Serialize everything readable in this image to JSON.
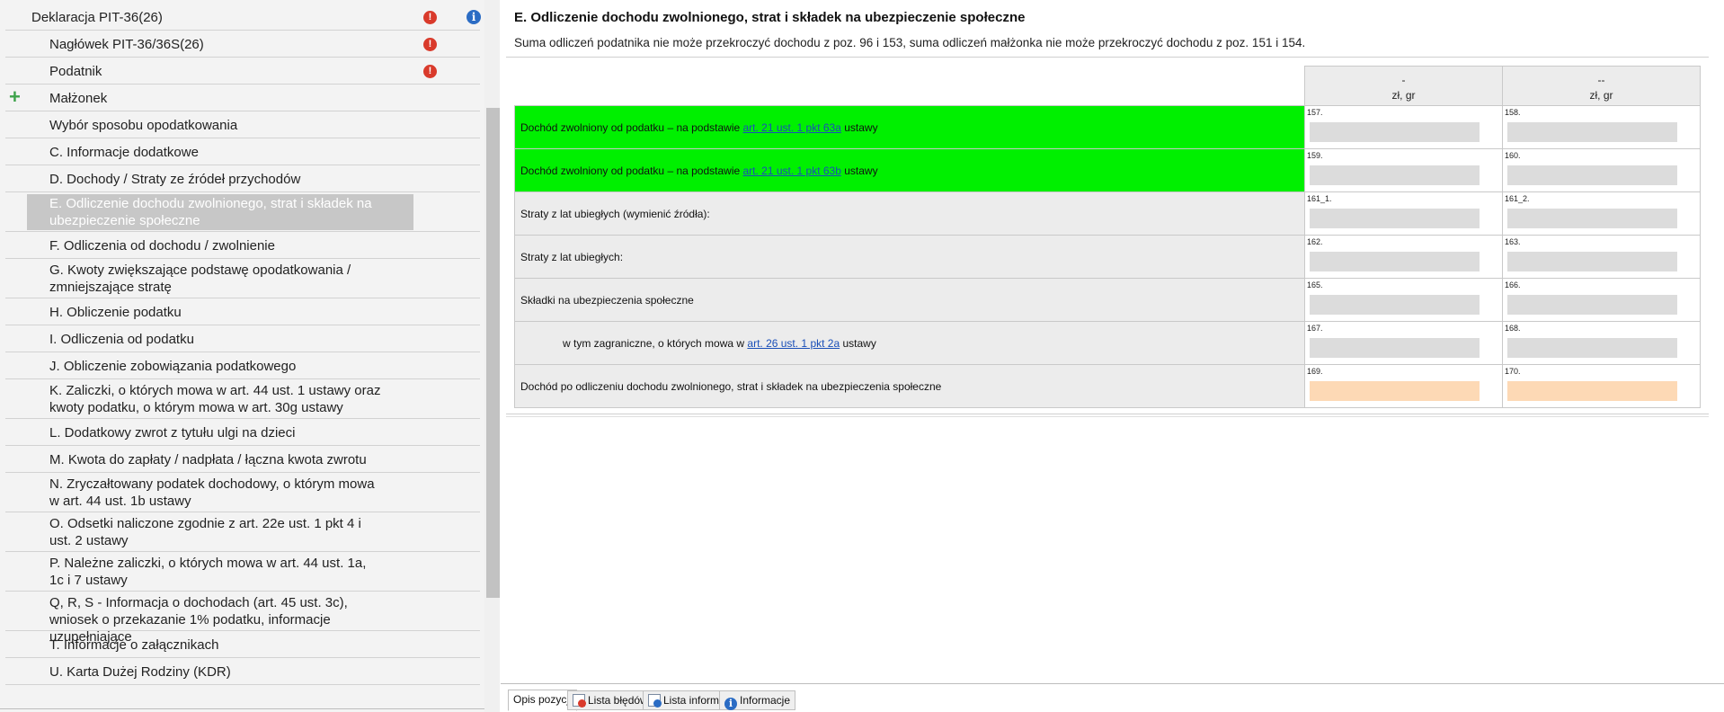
{
  "tree": {
    "items": [
      {
        "label": "Deklaracja PIT-36(26)",
        "root": true,
        "error": true,
        "info": true
      },
      {
        "label": "Nagłówek PIT-36/36S(26)",
        "error": true
      },
      {
        "label": "Podatnik",
        "error": true
      },
      {
        "label": "Małżonek",
        "plus": true
      },
      {
        "label": "Wybór sposobu opodatkowania"
      },
      {
        "label": "C. Informacje dodatkowe"
      },
      {
        "label": "D. Dochody / Straty ze źródeł przychodów"
      },
      {
        "label": "E. Odliczenie dochodu zwolnionego, strat i składek na ubezpieczenie społeczne",
        "selected": true,
        "double": true
      },
      {
        "label": "F. Odliczenia od dochodu / zwolnienie"
      },
      {
        "label": "G. Kwoty zwiększające podstawę opodatkowania / zmniejszające stratę",
        "double": true
      },
      {
        "label": "H. Obliczenie podatku"
      },
      {
        "label": "I. Odliczenia od podatku"
      },
      {
        "label": "J. Obliczenie zobowiązania podatkowego"
      },
      {
        "label": "K. Zaliczki, o których mowa w art. 44 ust. 1 ustawy oraz kwoty podatku, o którym mowa w art. 30g ustawy",
        "double": true
      },
      {
        "label": "L. Dodatkowy zwrot z tytułu ulgi na dzieci"
      },
      {
        "label": "M. Kwota do zapłaty / nadpłata / łączna kwota zwrotu"
      },
      {
        "label": "N. Zryczałtowany podatek dochodowy, o którym mowa w art. 44 ust. 1b ustawy",
        "double": true
      },
      {
        "label": "O. Odsetki naliczone zgodnie z art. 22e ust. 1 pkt 4 i ust. 2 ustawy",
        "double": true
      },
      {
        "label": "P. Należne zaliczki, o których mowa w art. 44 ust. 1a, 1c i 7 ustawy",
        "double": true
      },
      {
        "label": "Q, R, S - Informacja o dochodach (art. 45 ust. 3c), wniosek o przekazanie 1% podatku, informacje uzupełniające",
        "double": true
      },
      {
        "label": "T. Informacje o załącznikach"
      },
      {
        "label": "U. Karta Dużej Rodziny (KDR)"
      }
    ]
  },
  "section": {
    "title": "E. Odliczenie dochodu zwolnionego, strat i składek na ubezpieczenie społeczne",
    "note": "Suma odliczeń podatnika nie może przekroczyć dochodu z poz. 96 i 153, suma odliczeń małżonka nie może przekroczyć dochodu z poz. 151 i 154."
  },
  "grid": {
    "columns": [
      {
        "header": "-",
        "unit": "zł, gr"
      },
      {
        "header": "--",
        "unit": "zł, gr"
      }
    ],
    "rows": [
      {
        "pre": "Dochód zwolniony od podatku – na podstawie ",
        "link": "art. 21 ust. 1 pkt 63a",
        "post": " ustawy",
        "green": true,
        "cells": [
          "157.",
          "158."
        ]
      },
      {
        "pre": "Dochód zwolniony od podatku – na podstawie ",
        "link": "art. 21 ust. 1 pkt 63b",
        "post": " ustawy",
        "green": true,
        "cells": [
          "159.",
          "160."
        ]
      },
      {
        "pre": "Straty z lat ubiegłych (wymienić źródła):",
        "cells": [
          "161_1.",
          "161_2."
        ]
      },
      {
        "pre": "Straty z lat ubiegłych:",
        "cells": [
          "162.",
          "163."
        ]
      },
      {
        "pre": "Składki na ubezpieczenia społeczne",
        "cells": [
          "165.",
          "166."
        ]
      },
      {
        "pre": "w tym zagraniczne, o których mowa w ",
        "link": "art. 26 ust. 1 pkt 2a",
        "post": " ustawy",
        "indent": true,
        "cells": [
          "167.",
          "168."
        ]
      },
      {
        "pre": "Dochód po odliczeniu dochodu zwolnionego, strat i składek na ubezpieczenia społeczne",
        "orange": true,
        "cells": [
          "169.",
          "170."
        ]
      }
    ]
  },
  "tabs": [
    {
      "label": "Opis pozycji",
      "active": true,
      "icon": ""
    },
    {
      "label": "Lista błędów",
      "icon": "error-list-icon"
    },
    {
      "label": "Lista informacji",
      "icon": "info-list-icon"
    },
    {
      "label": "Informacje",
      "icon": "info-icon"
    }
  ]
}
